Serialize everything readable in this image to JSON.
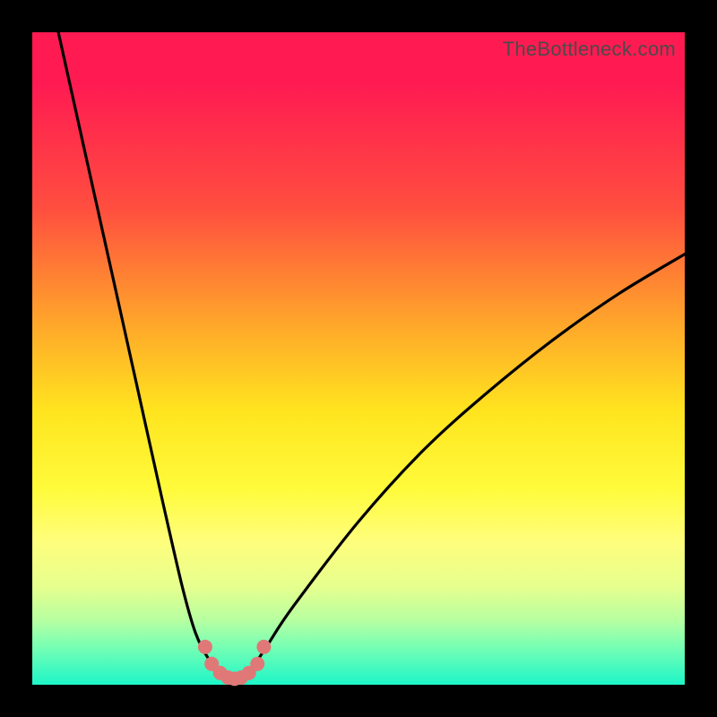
{
  "watermark": "TheBottleneck.com",
  "colors": {
    "frame": "#000000",
    "curve": "#000000",
    "marker": "#e07878",
    "gradient_top": "#ff1b52",
    "gradient_bottom": "#1df5c8"
  },
  "chart_data": {
    "type": "line",
    "title": "",
    "xlabel": "",
    "ylabel": "",
    "xlim": [
      0,
      100
    ],
    "ylim": [
      0,
      100
    ],
    "x_optimum": 31,
    "series": [
      {
        "name": "bottleneck-curve",
        "x": [
          4,
          8,
          12,
          16,
          20,
          23,
          25,
          27,
          29,
          30,
          31,
          32,
          33,
          34,
          36,
          40,
          50,
          60,
          70,
          80,
          90,
          100
        ],
        "y": [
          100,
          82,
          64,
          46,
          28,
          15,
          8,
          4,
          2,
          1.2,
          1,
          1.2,
          2,
          3,
          6,
          12,
          25,
          36,
          45,
          53,
          60,
          66
        ]
      }
    ],
    "markers": {
      "name": "highlighted-region",
      "x": [
        26.5,
        27.5,
        28.8,
        30.0,
        31.0,
        32.0,
        33.2,
        34.5,
        35.5
      ],
      "y": [
        5.8,
        3.2,
        1.8,
        1.1,
        0.9,
        1.1,
        1.8,
        3.2,
        5.8
      ]
    }
  }
}
